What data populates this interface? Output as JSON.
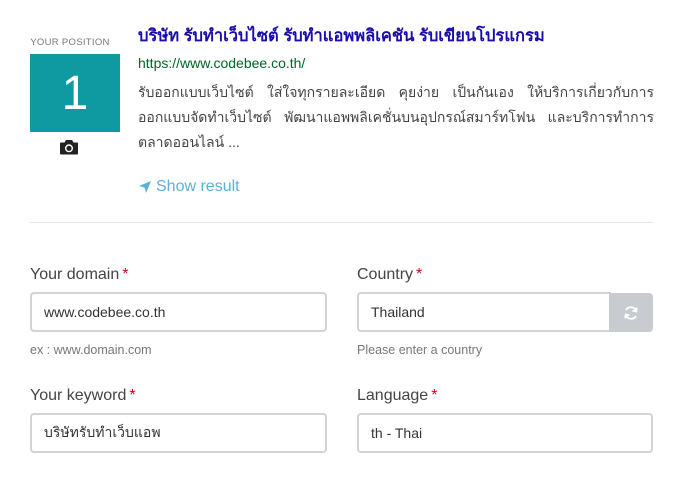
{
  "position": {
    "label": "YOUR POSITION",
    "value": "1"
  },
  "result": {
    "title": "บริษัท รับทำเว็บไซต์ รับทำแอพพลิเคชัน รับเขียนโปรแกรม",
    "url": "https://www.codebee.co.th/",
    "description": "รับออกแบบเว็บไซต์ ใส่ใจทุกรายละเอียด คุยง่าย เป็นกันเอง ให้บริการเกี่ยวกับการออกแบบจัดทำเว็บไซต์ พัฒนาแอพพลิเคชั่นบนอุปกรณ์สมาร์ทโฟน และบริการทำการตลาดออนไลน์ ...",
    "show_result_label": "Show result"
  },
  "form": {
    "domain": {
      "label": "Your domain",
      "required_mark": "*",
      "value": "www.codebee.co.th",
      "hint": "ex : www.domain.com"
    },
    "country": {
      "label": "Country",
      "required_mark": "*",
      "value": "Thailand",
      "hint": "Please enter a country"
    },
    "keyword": {
      "label": "Your keyword",
      "required_mark": "*",
      "value": "บริษัทรับทำเว็บแอพ"
    },
    "language": {
      "label": "Language",
      "required_mark": "*",
      "value": "th - Thai"
    }
  },
  "colors": {
    "position_box": "#0e9aa0",
    "title_link": "#1a0dab",
    "url": "#006621",
    "show_result": "#5bb0d6",
    "required": "#d0021b"
  }
}
